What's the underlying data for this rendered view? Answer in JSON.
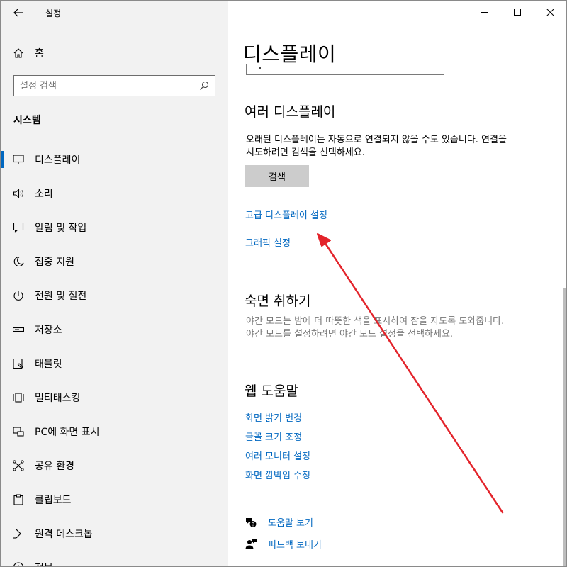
{
  "window": {
    "title": "설정",
    "controls": [
      "minimize",
      "maximize",
      "close"
    ]
  },
  "sidebar": {
    "home_label": "홈",
    "search_placeholder": "설정 검색",
    "section_title": "시스템",
    "items": [
      {
        "label": "디스플레이",
        "icon": "monitor-icon",
        "selected": true
      },
      {
        "label": "소리",
        "icon": "speaker-icon"
      },
      {
        "label": "알림 및 작업",
        "icon": "notification-icon"
      },
      {
        "label": "집중 지원",
        "icon": "moon-icon"
      },
      {
        "label": "전원 및 절전",
        "icon": "power-icon"
      },
      {
        "label": "저장소",
        "icon": "storage-icon"
      },
      {
        "label": "태블릿",
        "icon": "tablet-icon"
      },
      {
        "label": "멀티태스킹",
        "icon": "multitasking-icon"
      },
      {
        "label": "PC에 화면 표시",
        "icon": "project-icon"
      },
      {
        "label": "공유 환경",
        "icon": "shared-experiences-icon"
      },
      {
        "label": "클립보드",
        "icon": "clipboard-icon"
      },
      {
        "label": "원격 데스크톱",
        "icon": "remote-desktop-icon"
      },
      {
        "label": "정보",
        "icon": "info-icon"
      }
    ]
  },
  "main": {
    "page_title": "디스플레이",
    "multiple_displays": {
      "heading": "여러 디스플레이",
      "description_line1": "오래된 디스플레이는 자동으로 연결되지 않을 수도 있습니다. 연결을",
      "description_line2": "시도하려면 검색을 선택하세요.",
      "detect_button": "검색"
    },
    "links": {
      "advanced_display": "고급 디스플레이 설정",
      "graphics": "그래픽 설정"
    },
    "sleep_better": {
      "heading": "숙면 취하기",
      "description_line1": "야간 모드는 밤에 더 따뜻한 색을 표시하여 잠을 자도록 도와줍니다.",
      "description_line2": "야간 모드를 설정하려면 야간 모드 설정을 선택하세요."
    },
    "web_help": {
      "heading": "웹 도움말",
      "links": [
        "화면 밝기 변경",
        "글꼴 크기 조정",
        "여러 모니터 설정",
        "화면 깜박임 수정"
      ]
    },
    "get_help": "도움말 보기",
    "give_feedback": "피드백 보내기"
  },
  "colors": {
    "accent": "#0067c0",
    "annotation_arrow": "#e3242b"
  }
}
